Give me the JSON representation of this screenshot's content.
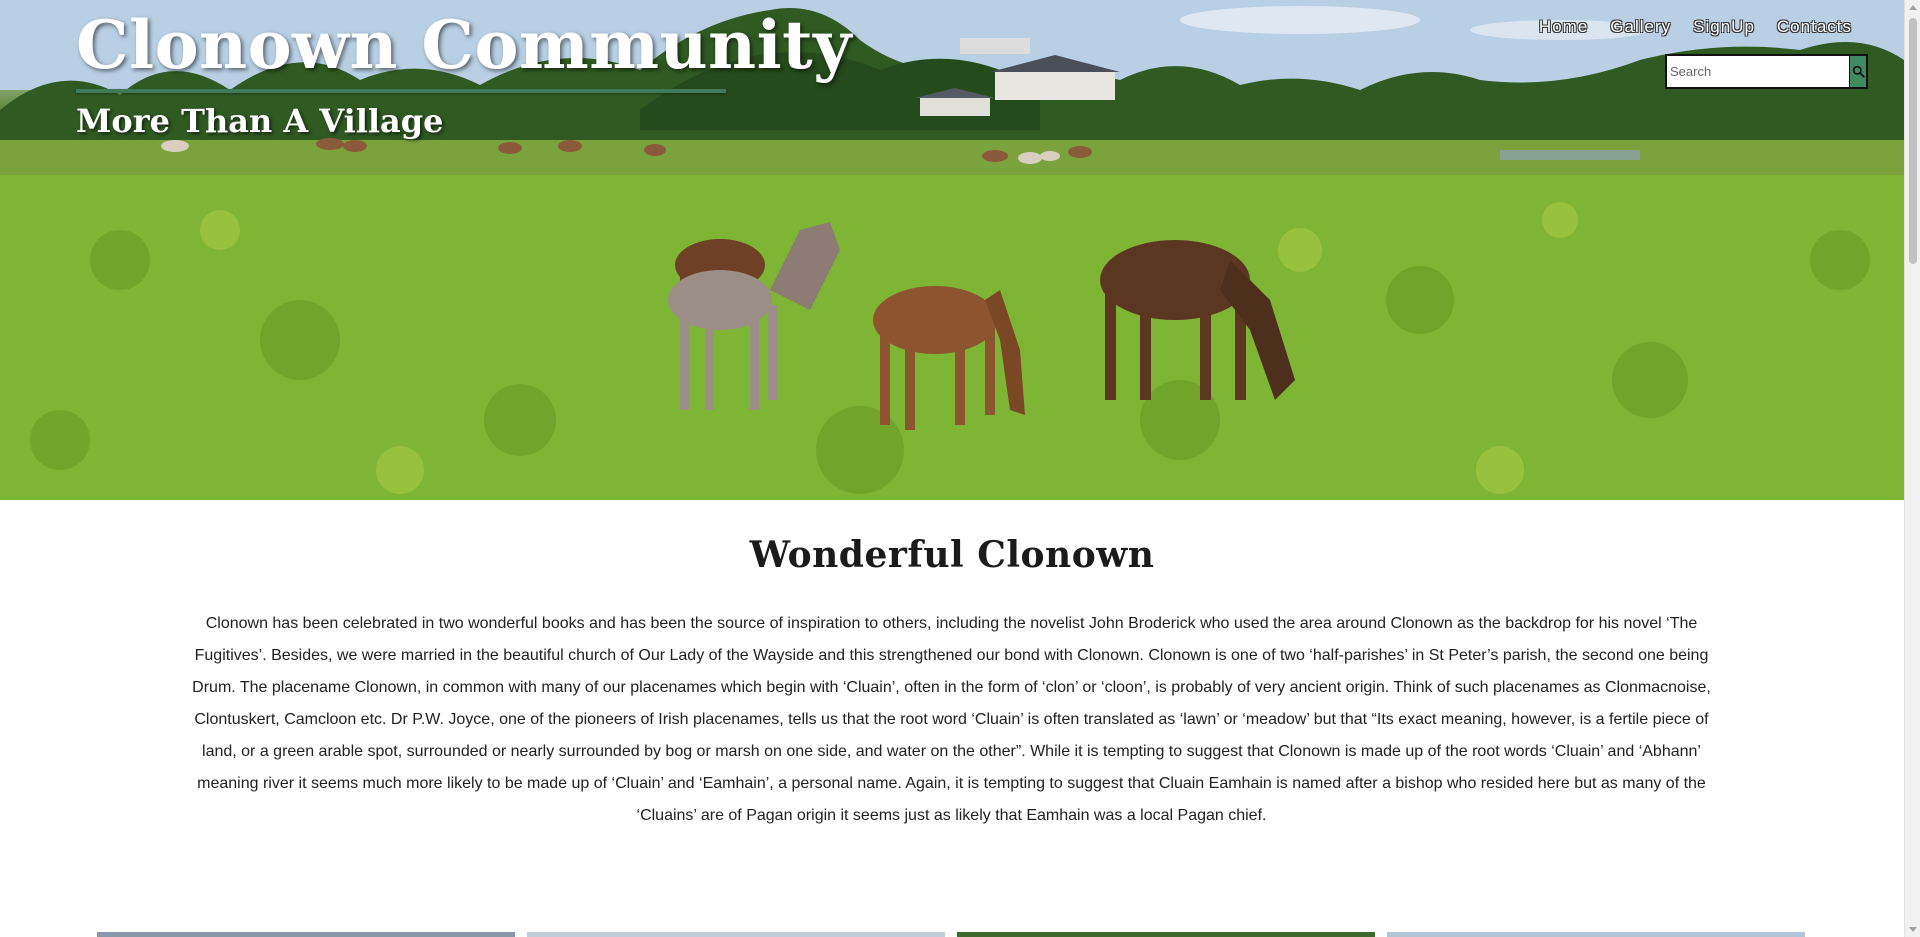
{
  "header": {
    "title": "Clonown Community",
    "subtitle": "More Than A Village",
    "nav": [
      "Home",
      "Gallery",
      "SignUp",
      "Contacts"
    ],
    "search": {
      "placeholder": "Search",
      "button_icon": "search-icon"
    },
    "hero_image": "horses-grazing-meadow"
  },
  "main": {
    "heading": "Wonderful Clonown",
    "intro": "Clonown has been celebrated in two wonderful books and has been the source of inspiration to others, including the novelist John Broderick who used the area around Clonown as the backdrop for his novel ‘The Fugitives’. Besides, we were married in the beautiful church of Our Lady of the Wayside and this strengthened our bond with Clonown. Clonown is one of two ‘half-parishes’ in St Peter’s parish, the second one being Drum. The placename Clonown, in common with many of our placenames which begin with ‘Cluain’, often in the form of ‘clon’ or ‘cloon’, is probably of very ancient origin. Think of such placenames as Clonmacnoise, Clontuskert, Camcloon etc. Dr P.W. Joyce, one of the pioneers of Irish placenames, tells us that the root word ‘Cluain’ is often translated as ‘lawn’ or ‘meadow’ but that “Its exact meaning, however, is a fertile piece of land, or a green arable spot, surrounded or nearly surrounded by bog or marsh on one side, and water on the other”. While it is tempting to suggest that Clonown is made up of the root words ‘Cluain’ and ‘Abhann’ meaning river it seems much more likely to be made up of ‘Cluain’ and ‘Eamhain’, a personal name. Again, it is tempting to suggest that Cluain Eamhain is named after a bishop who resided here but as many of the ‘Cluains’ are of Pagan origin it seems just as likely that Eamhain was a local Pagan chief."
  },
  "colors": {
    "accent_green": "#3f8a5f",
    "title_rule": "#3f7a5b",
    "text": "#222222"
  }
}
